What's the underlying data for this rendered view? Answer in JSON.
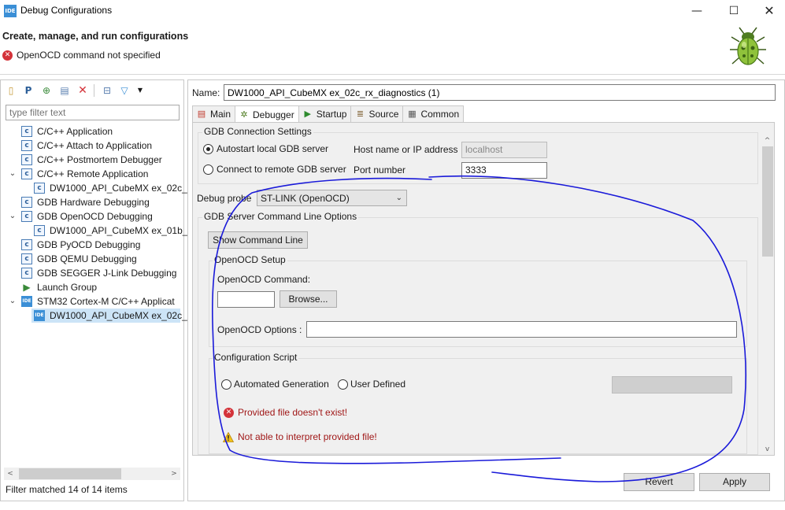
{
  "window": {
    "title": "Debug Configurations",
    "app_icon": "IDE",
    "minimize_glyph": "—",
    "maximize_glyph": "☐",
    "close_glyph": "✕"
  },
  "header": {
    "title": "Create, manage, and run configurations",
    "error_message": "OpenOCD command not specified",
    "error_icon": "error-icon"
  },
  "left": {
    "toolbar_icons": [
      "new-configuration-icon",
      "new-prototype-icon",
      "export-icon",
      "duplicate-icon",
      "delete-icon",
      "collapse-all-icon",
      "filter-icon",
      "view-menu-icon"
    ],
    "filter_placeholder": "type filter text",
    "tree": [
      {
        "label": "C/C++ Application",
        "icon": "c-icon",
        "glyph": "c"
      },
      {
        "label": "C/C++ Attach to Application",
        "icon": "c-icon",
        "glyph": "c"
      },
      {
        "label": "C/C++ Postmortem Debugger",
        "icon": "c-icon",
        "glyph": "c"
      },
      {
        "label": "C/C++ Remote Application",
        "icon": "c-icon",
        "glyph": "c",
        "expanded": true
      },
      {
        "label": "DW1000_API_CubeMX ex_02c_",
        "icon": "c-icon",
        "glyph": "c"
      },
      {
        "label": "GDB Hardware Debugging",
        "icon": "c-icon",
        "glyph": "c"
      },
      {
        "label": "GDB OpenOCD Debugging",
        "icon": "c-icon",
        "glyph": "c",
        "expanded": true
      },
      {
        "label": "DW1000_API_CubeMX ex_01b_",
        "icon": "c-icon",
        "glyph": "c"
      },
      {
        "label": "GDB PyOCD Debugging",
        "icon": "c-icon",
        "glyph": "c"
      },
      {
        "label": "GDB QEMU Debugging",
        "icon": "c-icon",
        "glyph": "c"
      },
      {
        "label": "GDB SEGGER J-Link Debugging",
        "icon": "c-icon",
        "glyph": "c"
      },
      {
        "label": "Launch Group",
        "icon": "launch-group-icon",
        "glyph": "▶"
      },
      {
        "label": "STM32 Cortex-M C/C++ Applicat",
        "icon": "ide-icon",
        "glyph": "IDE",
        "expanded": true
      },
      {
        "label": "DW1000_API_CubeMX ex_02c_",
        "icon": "ide-icon",
        "glyph": "IDE",
        "selected": true
      }
    ],
    "twisty_expanded": "⌄",
    "scroll_left": "<",
    "scroll_right": ">",
    "filter_status": "Filter matched 14 of 14 items"
  },
  "right": {
    "name_label": "Name:",
    "name_value": "DW1000_API_CubeMX ex_02c_rx_diagnostics (1)",
    "tabs": [
      {
        "label": "Main",
        "icon": "main-tab-icon",
        "glyph": "▤"
      },
      {
        "label": "Debugger",
        "icon": "debugger-tab-icon",
        "glyph": "✲",
        "active": true
      },
      {
        "label": "Startup",
        "icon": "startup-tab-icon",
        "glyph": "▶"
      },
      {
        "label": "Source",
        "icon": "source-tab-icon",
        "glyph": "≣"
      },
      {
        "label": "Common",
        "icon": "common-tab-icon",
        "glyph": "▦"
      }
    ],
    "gdb_connection": {
      "title": "GDB Connection Settings",
      "autostart_label": "Autostart local GDB server",
      "connect_remote_label": "Connect to remote GDB server",
      "host_label": "Host name or IP address",
      "host_value": "localhost",
      "port_label": "Port number",
      "port_value": "3333"
    },
    "debug_probe": {
      "label": "Debug probe",
      "value": "ST-LINK (OpenOCD)",
      "arrow": "⌄"
    },
    "gdb_server_options": {
      "title": "GDB Server Command Line Options",
      "show_command_line": "Show Command Line"
    },
    "openocd_setup": {
      "title": "OpenOCD Setup",
      "command_label": "OpenOCD Command:",
      "command_value": "",
      "browse": "Browse...",
      "options_label": "OpenOCD Options :",
      "options_value": ""
    },
    "config_script": {
      "title": "Configuration Script",
      "automated_label": "Automated Generation",
      "user_defined_label": "User Defined",
      "error_msg": "Provided file doesn't exist!",
      "warning_msg": "Not able to interpret provided file!"
    },
    "scroll_up": "^",
    "scroll_down": "v",
    "revert": "Revert",
    "apply": "Apply"
  },
  "colors": {
    "selection": "#cce4f7",
    "error": "#d4333a",
    "annotation": "#1a1ad9"
  }
}
